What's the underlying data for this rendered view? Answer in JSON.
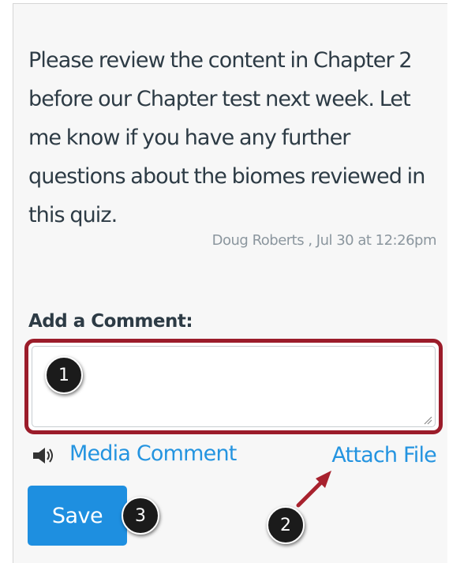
{
  "comment": {
    "text": "Please review the content in Chapter 2 before our Chapter test next week. Let me know if you have any further questions about the biomes reviewed in this quiz.",
    "meta": "Doug Roberts , Jul 30 at 12:26pm"
  },
  "add_comment": {
    "label": "Add a Comment:",
    "value": "",
    "placeholder": ""
  },
  "actions": {
    "media_comment": "Media Comment",
    "attach_file": "Attach File",
    "save": "Save"
  },
  "callouts": {
    "one": "1",
    "two": "2",
    "three": "3"
  },
  "colors": {
    "link": "#2494e0",
    "save_button": "#1e8fe0",
    "highlight_border": "#9b1c2a",
    "callout": "#1b1b1b",
    "text": "#2d3b45",
    "meta_text": "#8b969e"
  },
  "icons": {
    "speaker": "speaker-icon",
    "resize": "resize-handle-icon",
    "arrow": "arrow-icon"
  }
}
